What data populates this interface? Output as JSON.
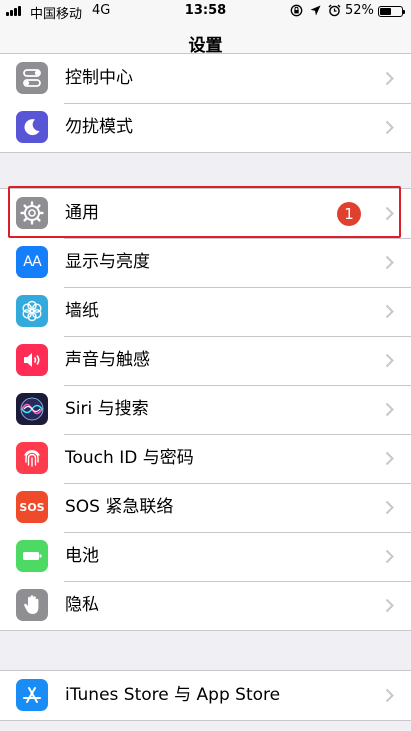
{
  "status_bar": {
    "carrier": "中国移动",
    "network": "4G",
    "time": "13:58",
    "battery_percent": "52%",
    "battery_level": 0.52,
    "icons": [
      "orientation-lock-icon",
      "location-icon",
      "alarm-icon"
    ]
  },
  "nav": {
    "title": "设置"
  },
  "settings": {
    "group1": [
      {
        "label": "控制中心",
        "icon": "control-center-icon",
        "icon_color": "#8e8e93"
      },
      {
        "label": "勿扰模式",
        "icon": "moon-icon",
        "icon_color": "#5856d6"
      }
    ],
    "group2": [
      {
        "label": "通用",
        "icon": "gear-icon",
        "icon_color": "#8e8e93",
        "badge": "1"
      },
      {
        "label": "显示与亮度",
        "icon": "display-brightness-icon",
        "icon_color": "#147efb",
        "glyph": "AA"
      },
      {
        "label": "墙纸",
        "icon": "wallpaper-flower-icon",
        "icon_color": "#34aadc"
      },
      {
        "label": "声音与触感",
        "icon": "speaker-icon",
        "icon_color": "#ff2d55"
      },
      {
        "label": "Siri 与搜索",
        "icon": "siri-icon",
        "icon_color": "#1c1c3a"
      },
      {
        "label": "Touch ID 与密码",
        "icon": "fingerprint-icon",
        "icon_color": "#ff3b4e"
      },
      {
        "label": "SOS 紧急联络",
        "icon": "sos-icon",
        "icon_color": "#ef4a2a",
        "glyph": "SOS"
      },
      {
        "label": "电池",
        "icon": "battery-icon",
        "icon_color": "#4cd964"
      },
      {
        "label": "隐私",
        "icon": "hand-icon",
        "icon_color": "#8e8e93"
      }
    ],
    "group3": [
      {
        "label": "iTunes Store 与 App Store",
        "icon": "app-store-icon",
        "icon_color": "#1a8cf5"
      }
    ]
  }
}
